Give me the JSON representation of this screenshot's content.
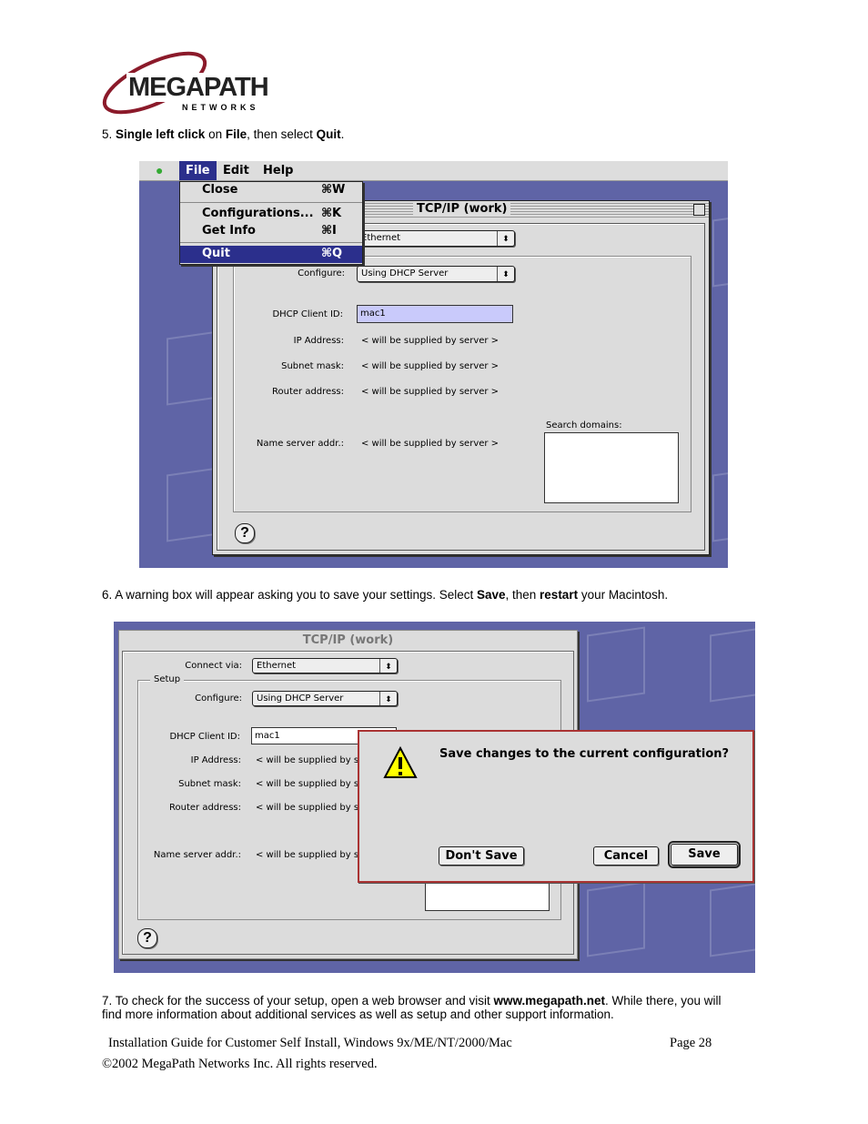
{
  "logo": {
    "text": "MEGAPATH",
    "sub": "NETWORKS"
  },
  "step5": {
    "num": "5.",
    "b1": "Single left click",
    "t1": " on ",
    "b2": "File",
    "t2": ", then select ",
    "b3": "Quit",
    "t3": "."
  },
  "shot1": {
    "menubar": [
      "File",
      "Edit",
      "Help"
    ],
    "menu": [
      {
        "label": "Close",
        "key": "⌘W"
      },
      {
        "label": "Configurations...",
        "key": "⌘K"
      },
      {
        "label": "Get Info",
        "key": "⌘I"
      },
      {
        "label": "Quit",
        "key": "⌘Q"
      }
    ],
    "title": "TCP/IP (work)",
    "connect_value": "Ethernet",
    "configure_label": "Configure:",
    "configure_value": "Using DHCP Server",
    "dhcp_label": "DHCP Client ID:",
    "dhcp_value": "mac1",
    "rows": [
      {
        "label": "IP Address:",
        "value": "< will be supplied by server >"
      },
      {
        "label": "Subnet mask:",
        "value": "< will be supplied by server >"
      },
      {
        "label": "Router address:",
        "value": "< will be supplied by server >"
      },
      {
        "label": "Name server addr.:",
        "value": "< will be supplied by server >"
      }
    ],
    "search_label": "Search domains:",
    "help": "?"
  },
  "step6": {
    "t1": "6. A warning box will appear asking you to save your settings. Select ",
    "b1": "Save",
    "t2": ", then ",
    "b2": "restart",
    "t3": " your Macintosh."
  },
  "shot2": {
    "title": "TCP/IP (work)",
    "connect_label": "Connect via:",
    "connect_value": "Ethernet",
    "setup": "Setup",
    "configure_label": "Configure:",
    "configure_value": "Using DHCP Server",
    "dhcp_label": "DHCP Client ID:",
    "dhcp_value": "mac1",
    "rows": [
      {
        "label": "IP Address:",
        "value": "< will be supplied by se"
      },
      {
        "label": "Subnet mask:",
        "value": "< will be supplied by se"
      },
      {
        "label": "Router address:",
        "value": "< will be supplied by se"
      },
      {
        "label": "Name server addr.:",
        "value": "< will be supplied by se"
      }
    ],
    "dialog": {
      "message": "Save changes to the current configuration?",
      "dont_save": "Don't Save",
      "cancel": "Cancel",
      "save": "Save"
    },
    "help": "?"
  },
  "step7": {
    "t1": "7. To check for the success of your setup, open a web browser and visit ",
    "b1": "www.megapath.net",
    "t2": ". While there, you will",
    "line2": "find more information about additional services as well as setup and other support information."
  },
  "footer": {
    "guide": "Installation Guide for Customer Self Install, Windows 9x/ME/NT/2000/Mac",
    "page": "Page 28",
    "copyright": "©2002 MegaPath Networks Inc. All rights reserved."
  }
}
